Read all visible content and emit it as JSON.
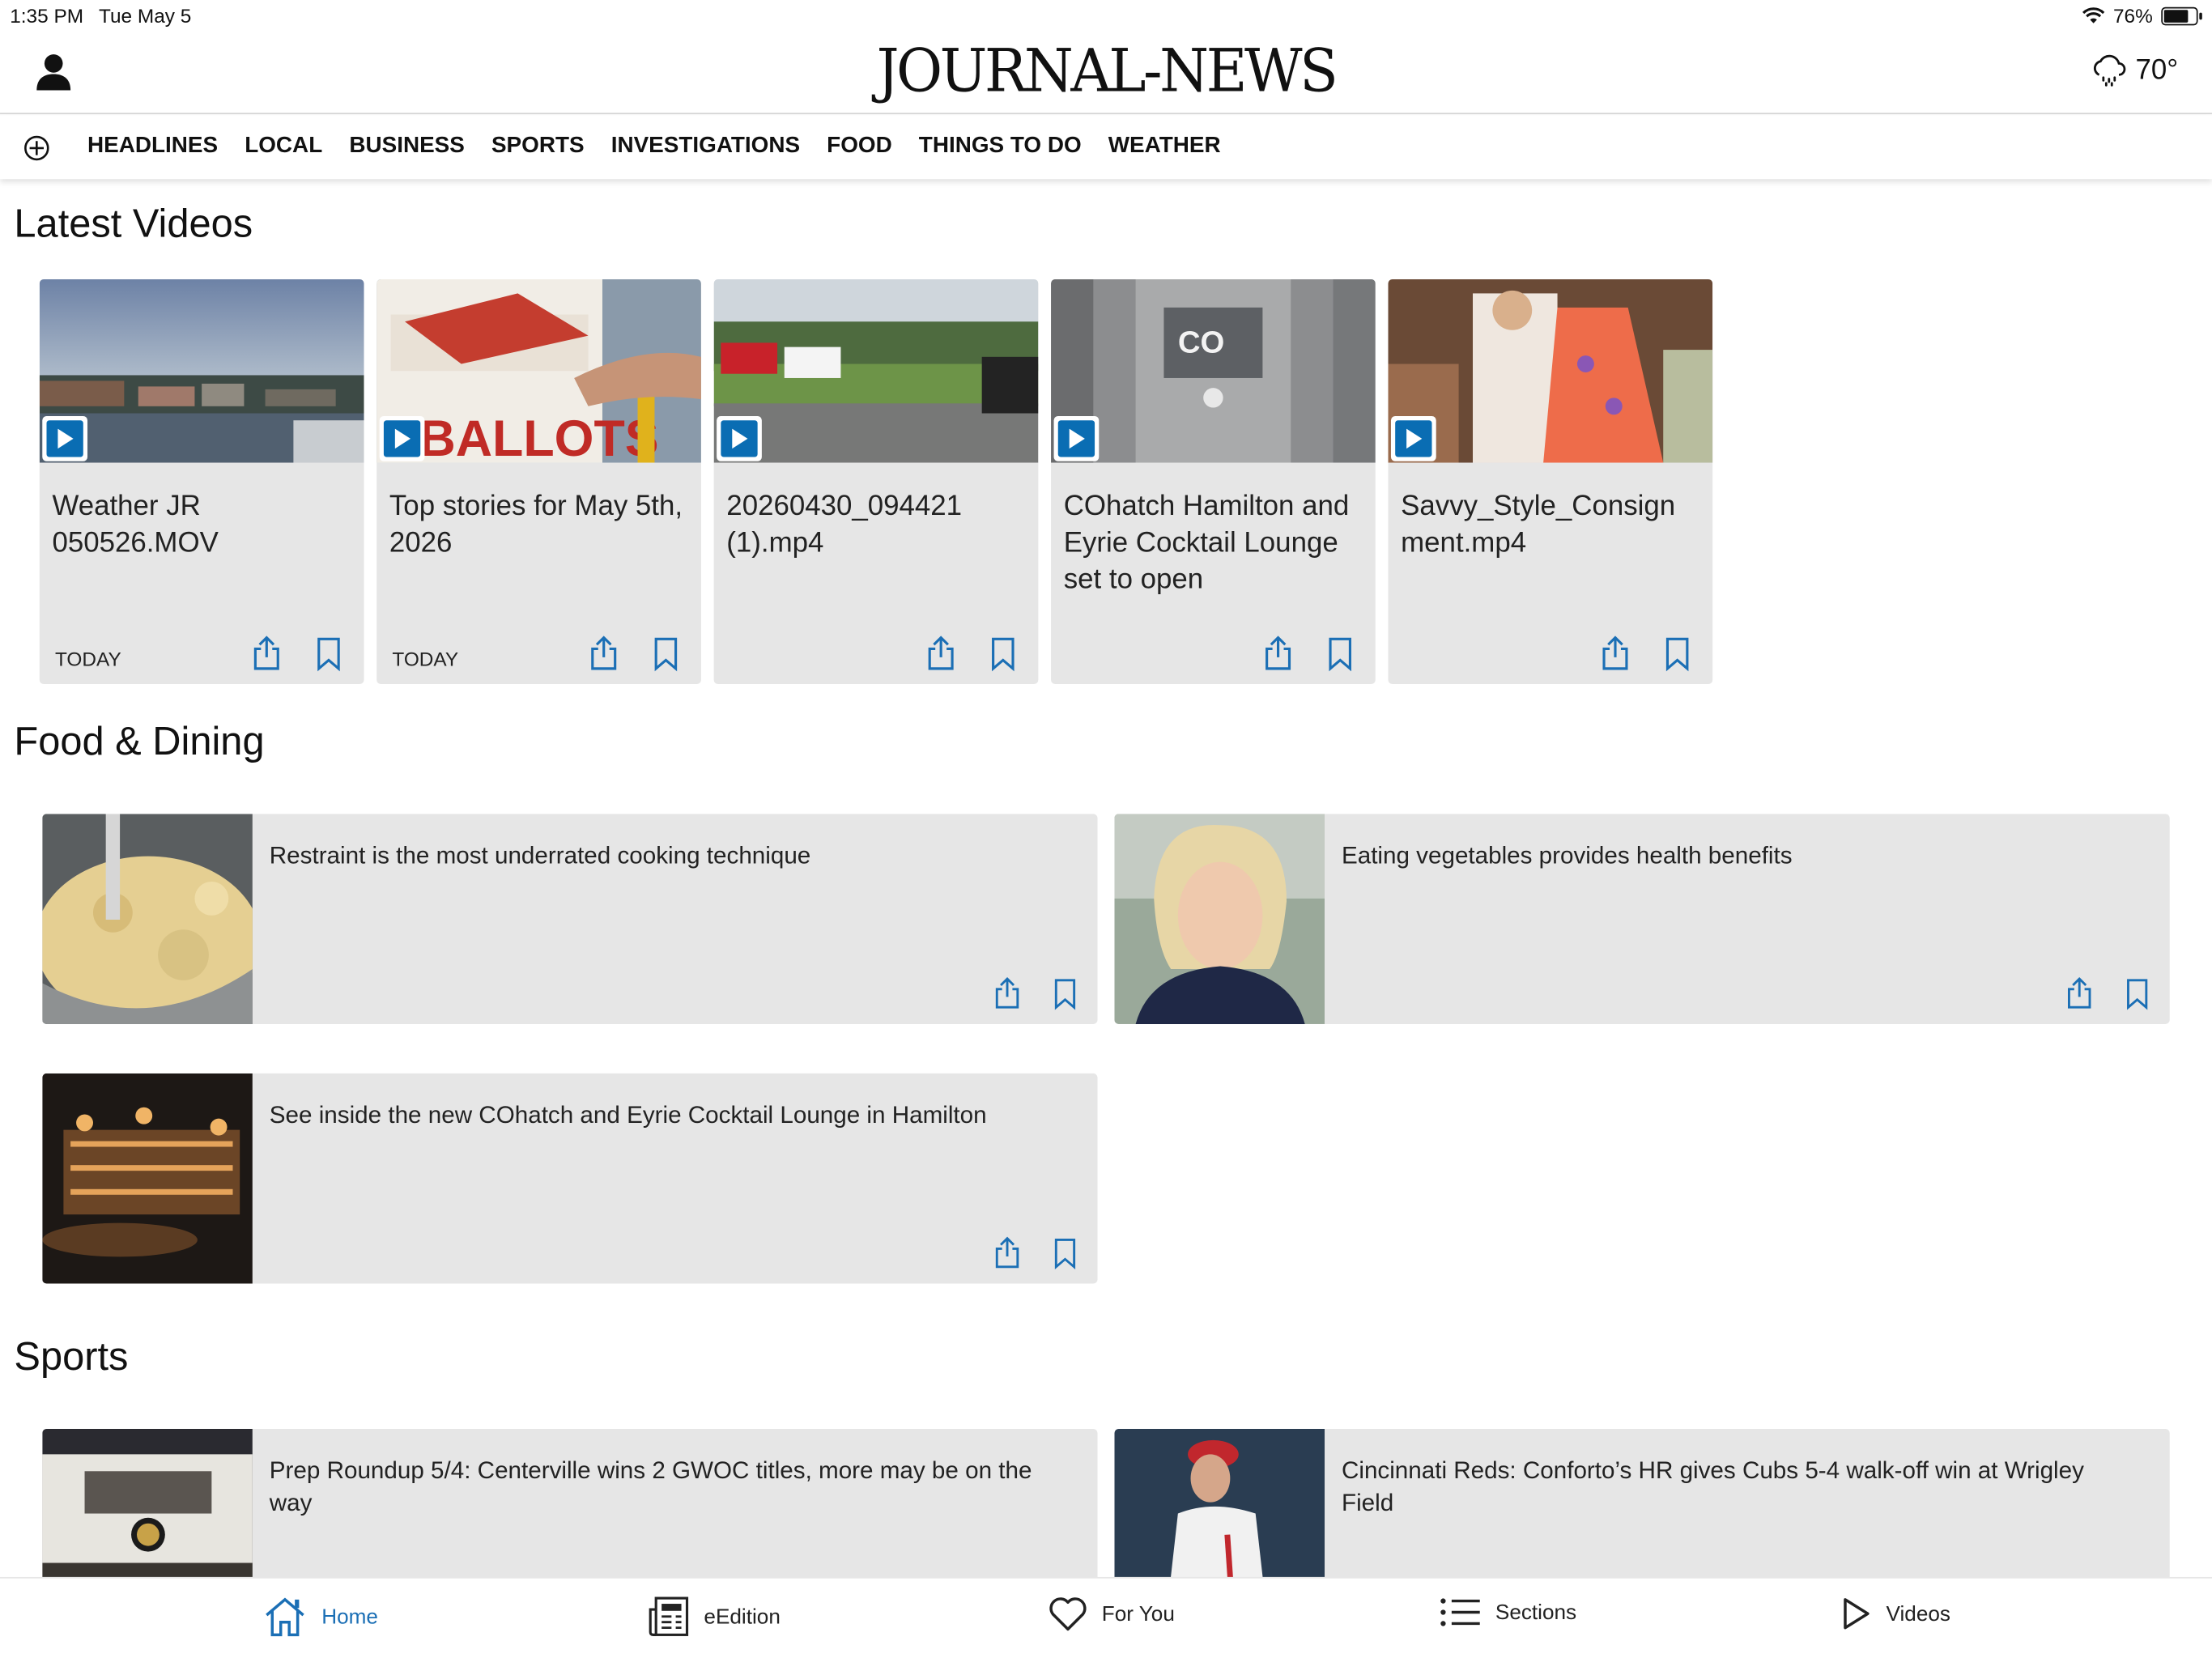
{
  "status_bar": {
    "time": "1:35 PM",
    "date": "Tue May 5",
    "battery": "76%",
    "battery_level": 0.76
  },
  "header": {
    "brand": "JOURNAL-NEWS",
    "temperature": "70°",
    "weather_icon": "rain-cloud-icon"
  },
  "nav": {
    "items": [
      "HEADLINES",
      "LOCAL",
      "BUSINESS",
      "SPORTS",
      "INVESTIGATIONS",
      "FOOD",
      "THINGS TO DO",
      "WEATHER"
    ]
  },
  "sections": {
    "latest_videos": "Latest Videos",
    "food_dining": "Food & Dining",
    "sports": "Sports"
  },
  "videos": [
    {
      "title": "Weather JR 050526.MOV",
      "date": "TODAY"
    },
    {
      "title": "Top stories for May 5th, 2026",
      "date": "TODAY"
    },
    {
      "title": "20260430_094421 (1).mp4",
      "date": ""
    },
    {
      "title": "COhatch Hamilton and Eyrie Cocktail Lounge set to open",
      "date": ""
    },
    {
      "title": "Savvy_Style_Consign ment.mp4",
      "date": ""
    }
  ],
  "food_articles": [
    {
      "title": "Restraint is the most underrated cooking technique"
    },
    {
      "title": "Eating vegetables provides health benefits"
    },
    {
      "title": "See inside the new COhatch and Eyrie Cocktail Lounge in Hamilton"
    }
  ],
  "sports_articles": [
    {
      "title": "Prep Roundup 5/4: Centerville wins 2 GWOC titles, more may be on the way"
    },
    {
      "title": "Cincinnati Reds: Conforto’s HR gives Cubs 5-4 walk-off win at Wrigley Field"
    }
  ],
  "tabbar": {
    "home": "Home",
    "eedition": "eEdition",
    "for_you": "For You",
    "sections": "Sections",
    "videos": "Videos"
  },
  "colors": {
    "accent": "#1b6fb5",
    "play": "#0a6db3",
    "card": "#e6e6e6"
  }
}
